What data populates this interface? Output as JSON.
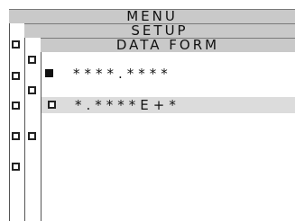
{
  "header": {
    "title": "MENU"
  },
  "submenu": {
    "title": "SETUP"
  },
  "panel": {
    "title": "DATA FORM"
  },
  "options": [
    {
      "label": "****.****",
      "selected": true
    },
    {
      "label": "*.****E+*",
      "selected": false
    }
  ],
  "colors": {
    "bar": "#c9c9c9",
    "highlight": "#dcdcdc"
  }
}
